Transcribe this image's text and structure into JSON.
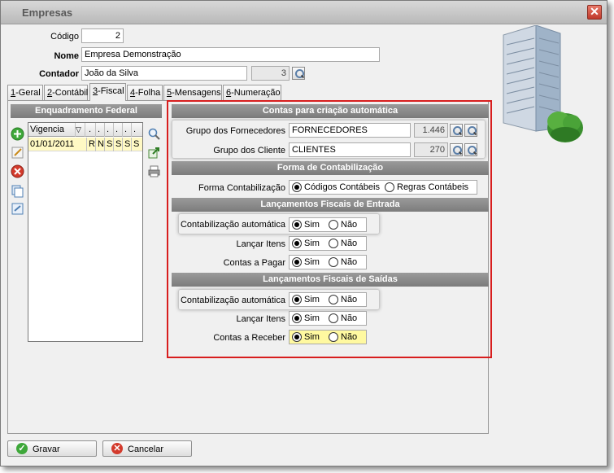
{
  "window": {
    "title": "Empresas",
    "close_glyph": "✕"
  },
  "form": {
    "codigo_label": "Código",
    "codigo_value": "2",
    "nome_label": "Nome",
    "nome_value": "Empresa Demonstração",
    "contador_label": "Contador",
    "contador_value": "João da Silva",
    "contador_code": "3"
  },
  "tabs": [
    {
      "key": "1",
      "label": "-Geral"
    },
    {
      "key": "2",
      "label": "-Contábil"
    },
    {
      "key": "3",
      "label": "-Fiscal"
    },
    {
      "key": "4",
      "label": "-Folha"
    },
    {
      "key": "5",
      "label": "-Mensagens"
    },
    {
      "key": "6",
      "label": "-Numeração"
    }
  ],
  "active_tab": "3-Fiscal",
  "enquadramento": {
    "header": "Enquadramento Federal",
    "columns": [
      "Vigencia",
      "▽",
      ".",
      ".",
      ".",
      ".",
      ".",
      "."
    ],
    "rows": [
      {
        "vigencia": "01/01/2011",
        "flags": [
          "R",
          "N",
          "S",
          "S",
          "S",
          "S"
        ]
      }
    ]
  },
  "contas": {
    "header": "Contas para criação automática",
    "fornecedores_label": "Grupo dos Fornecedores",
    "fornecedores_value": "FORNECEDORES",
    "fornecedores_code": "1.446",
    "clientes_label": "Grupo dos Cliente",
    "clientes_value": "CLIENTES",
    "clientes_code": "270"
  },
  "forma": {
    "header": "Forma de Contabilização",
    "label": "Forma Contabilização",
    "opt1": "Códigos Contábeis",
    "opt2": "Regras Contábeis",
    "selected": "Códigos Contábeis"
  },
  "entrada": {
    "header": "Lançamentos Fiscais de Entrada",
    "rows": [
      {
        "label": "Contabilização automática",
        "yes": "Sim",
        "no": "Não",
        "value": "Sim"
      },
      {
        "label": "Lançar Itens",
        "yes": "Sim",
        "no": "Não",
        "value": "Sim"
      },
      {
        "label": "Contas a Pagar",
        "yes": "Sim",
        "no": "Não",
        "value": "Sim"
      }
    ]
  },
  "saidas": {
    "header": "Lançamentos Fiscais de Saídas",
    "rows": [
      {
        "label": "Contabilização automática",
        "yes": "Sim",
        "no": "Não",
        "value": "Sim"
      },
      {
        "label": "Lançar Itens",
        "yes": "Sim",
        "no": "Não",
        "value": "Sim"
      },
      {
        "label": "Contas a Receber",
        "yes": "Sim",
        "no": "Não",
        "value": "Sim"
      }
    ]
  },
  "buttons": {
    "save": "Gravar",
    "cancel": "Cancelar"
  },
  "colors": {
    "highlight_red": "#d81e1e",
    "row_yellow": "#fff9c4",
    "section_gray": "#8a8a8a"
  }
}
